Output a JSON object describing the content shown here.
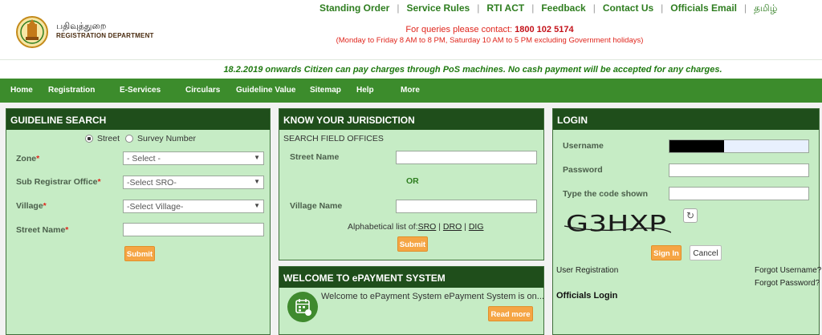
{
  "header": {
    "logo_tamil": "பதிவுத்துறை",
    "logo_english": "REGISTRATION DEPARTMENT",
    "top_links": [
      "Standing Order",
      "Service Rules",
      "RTI ACT",
      "Feedback",
      "Contact Us",
      "Officials Email"
    ],
    "tamil_link": "தமிழ்",
    "contact_prefix": "For queries please contact:",
    "contact_phone": "1800 102 5174",
    "contact_hours": "(Monday to Friday 8 AM to 8 PM, Saturday 10 AM to 5 PM excluding Government holidays)"
  },
  "notice": "18.2.2019 onwards Citizen can pay charges through PoS machines. No cash payment will be accepted for any charges.",
  "nav": [
    "Home",
    "Registration",
    "E-Services",
    "Circulars",
    "Guideline Value",
    "Sitemap",
    "Help",
    "More"
  ],
  "guideline": {
    "title": "GUIDELINE SEARCH",
    "radio_street": "Street",
    "radio_survey": "Survey Number",
    "zone_label": "Zone",
    "zone_value": "- Select -",
    "sro_label": "Sub Registrar Office",
    "sro_value": "-Select SRO-",
    "village_label": "Village",
    "village_value": "-Select Village-",
    "street_label": "Street Name",
    "required_mark": "*",
    "submit": "Submit"
  },
  "jurisdiction": {
    "title": "KNOW YOUR JURISDICTION",
    "subtitle": "SEARCH FIELD OFFICES",
    "street_label": "Street Name",
    "or": "OR",
    "village_label": "Village Name",
    "alpha_text": "Alphabetical list of:",
    "alpha_links": [
      "SRO",
      "DRO",
      "DIG"
    ],
    "alpha_sep": "|",
    "submit": "Submit"
  },
  "epayment": {
    "title": "WELCOME TO ePAYMENT SYSTEM",
    "text": "Welcome to ePayment System ePayment System is on...",
    "read_more": "Read more"
  },
  "login": {
    "title": "LOGIN",
    "username_label": "Username",
    "password_label": "Password",
    "code_label": "Type the code shown",
    "captcha_text": "G3HXP",
    "sign_in": "Sign In",
    "cancel": "Cancel",
    "user_registration": "User Registration",
    "forgot_username": "Forgot Username?",
    "forgot_password": "Forgot Password?",
    "officials_login": "Officials Login"
  },
  "colors": {
    "nav_green": "#3c8c2c",
    "panel_head": "#1f4e1b",
    "panel_bg": "#c6ecc5",
    "button_orange": "#f5a544",
    "alert_red": "#e0261d"
  }
}
